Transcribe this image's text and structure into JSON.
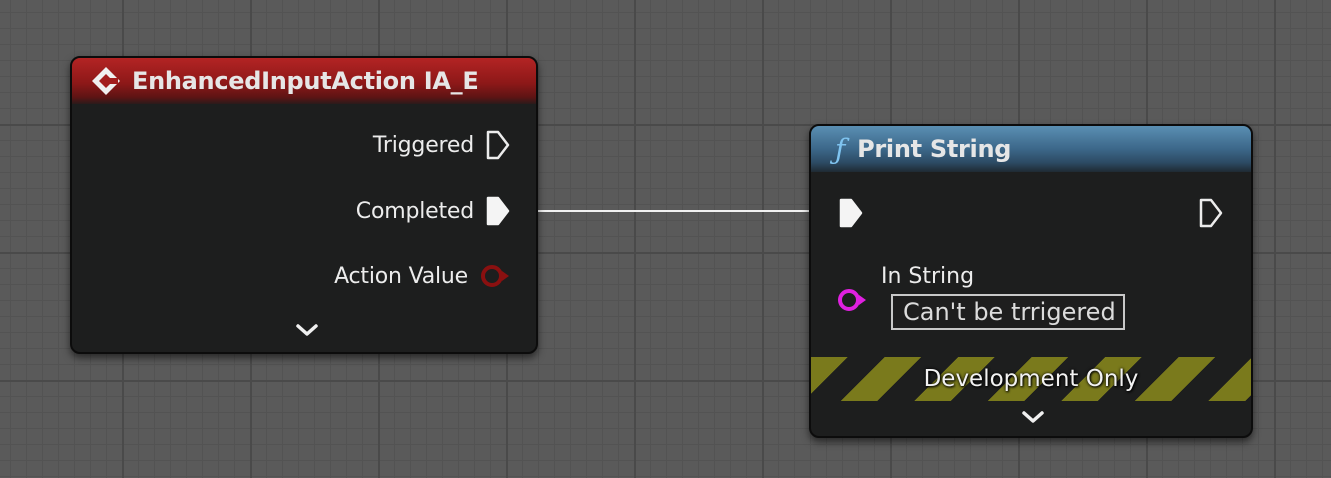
{
  "event_node": {
    "title": "EnhancedInputAction IA_E",
    "header_color": "#9c1c1c",
    "icon": "event-diamond-icon",
    "pins": {
      "triggered": "Triggered",
      "completed": "Completed",
      "action_value": "Action Value"
    },
    "action_value_pin_color": "#8a1010"
  },
  "print_node": {
    "title": "Print String",
    "header_color": "#3f6b8d",
    "icon": "function-icon",
    "in_string_label": "In String",
    "in_string_value": "Can't be trrigered",
    "string_pin_color": "#e020e0",
    "dev_only_label": "Development Only"
  },
  "wire_color": "#ffffff"
}
